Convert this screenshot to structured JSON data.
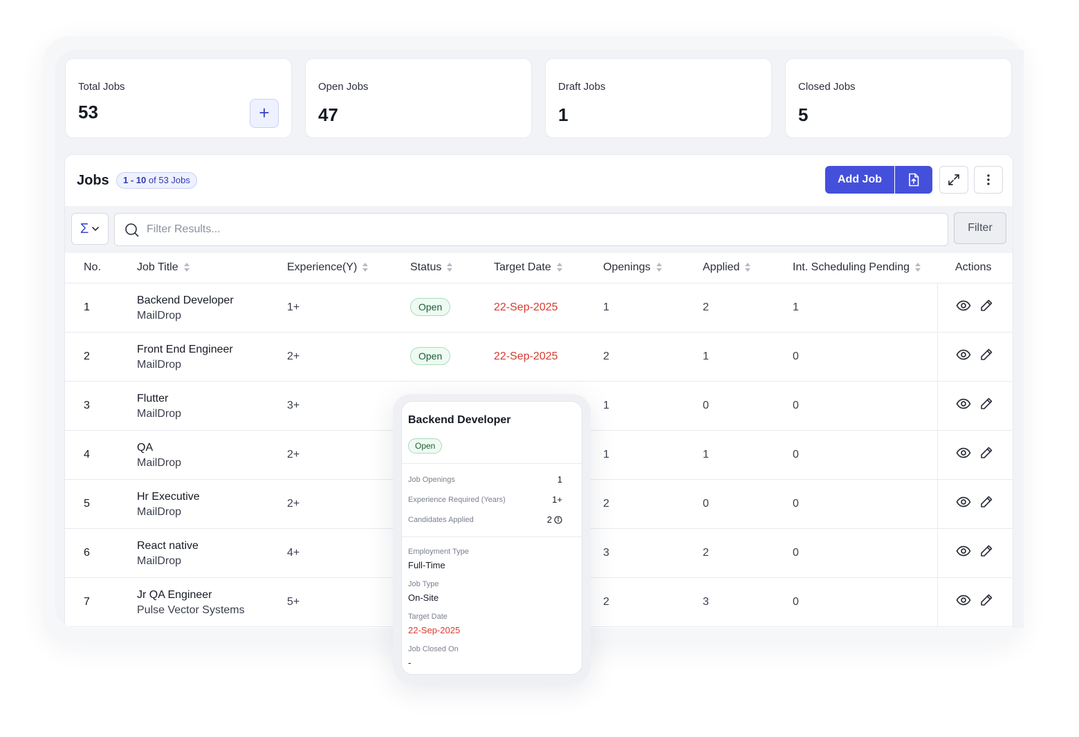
{
  "stats": [
    {
      "label": "Total Jobs",
      "value": "53",
      "add_icon": "plus-icon"
    },
    {
      "label": "Open Jobs",
      "value": "47"
    },
    {
      "label": "Draft Jobs",
      "value": "1"
    },
    {
      "label": "Closed Jobs",
      "value": "5"
    }
  ],
  "jobs_panel": {
    "title": "Jobs",
    "badge_range": "1 - 10",
    "badge_of": "of",
    "badge_total": "53 Jobs",
    "add_job_label": "Add Job",
    "filter_label": "Filter",
    "search_placeholder": "Filter Results...",
    "sigma_symbol": "Σ"
  },
  "table": {
    "headers": {
      "no": "No.",
      "job_title": "Job Title",
      "experience": "Experience(Y)",
      "status": "Status",
      "target_date": "Target Date",
      "openings": "Openings",
      "applied": "Applied",
      "int_scheduling": "Int. Scheduling Pending",
      "actions": "Actions"
    },
    "rows": [
      {
        "no": "1",
        "title": "Backend Developer",
        "company": "MailDrop",
        "experience": "1+",
        "status": "Open",
        "target_date": "22-Sep-2025",
        "openings": "1",
        "applied": "2",
        "int_pending": "1"
      },
      {
        "no": "2",
        "title": "Front End Engineer",
        "company": "MailDrop",
        "experience": "2+",
        "status": "Open",
        "target_date": "22-Sep-2025",
        "openings": "2",
        "applied": "1",
        "int_pending": "0"
      },
      {
        "no": "3",
        "title": "Flutter",
        "company": "MailDrop",
        "experience": "3+",
        "status": "",
        "target_date": "",
        "openings": "1",
        "applied": "0",
        "int_pending": "0"
      },
      {
        "no": "4",
        "title": "QA",
        "company": "MailDrop",
        "experience": "2+",
        "status": "",
        "target_date": "",
        "openings": "1",
        "applied": "1",
        "int_pending": "0"
      },
      {
        "no": "5",
        "title": "Hr Executive",
        "company": "MailDrop",
        "experience": "2+",
        "status": "",
        "target_date": "",
        "openings": "2",
        "applied": "0",
        "int_pending": "0"
      },
      {
        "no": "6",
        "title": "React native",
        "company": "MailDrop",
        "experience": "4+",
        "status": "",
        "target_date": "",
        "openings": "3",
        "applied": "2",
        "int_pending": "0"
      },
      {
        "no": "7",
        "title": "Jr QA Engineer",
        "company": "Pulse Vector Systems",
        "experience": "5+",
        "status": "",
        "target_date": "",
        "openings": "2",
        "applied": "3",
        "int_pending": "0"
      }
    ]
  },
  "popup": {
    "title": "Backend Developer",
    "status": "Open",
    "job_openings_label": "Job Openings",
    "job_openings_value": "1",
    "experience_label": "Experience Required (Years)",
    "experience_value": "1+",
    "candidates_label": "Candidates Applied",
    "candidates_value": "2",
    "employment_type_label": "Employment Type",
    "employment_type_value": "Full-Time",
    "job_type_label": "Job Type",
    "job_type_value": "On-Site",
    "target_date_label": "Target Date",
    "target_date_value": "22-Sep-2025",
    "closed_on_label": "Job Closed On",
    "closed_on_value": "-"
  },
  "colors": {
    "accent": "#4450db",
    "date_red": "#d93b2f",
    "status_green_bg": "#eefaf2",
    "status_green_border": "#a8dcbc"
  }
}
